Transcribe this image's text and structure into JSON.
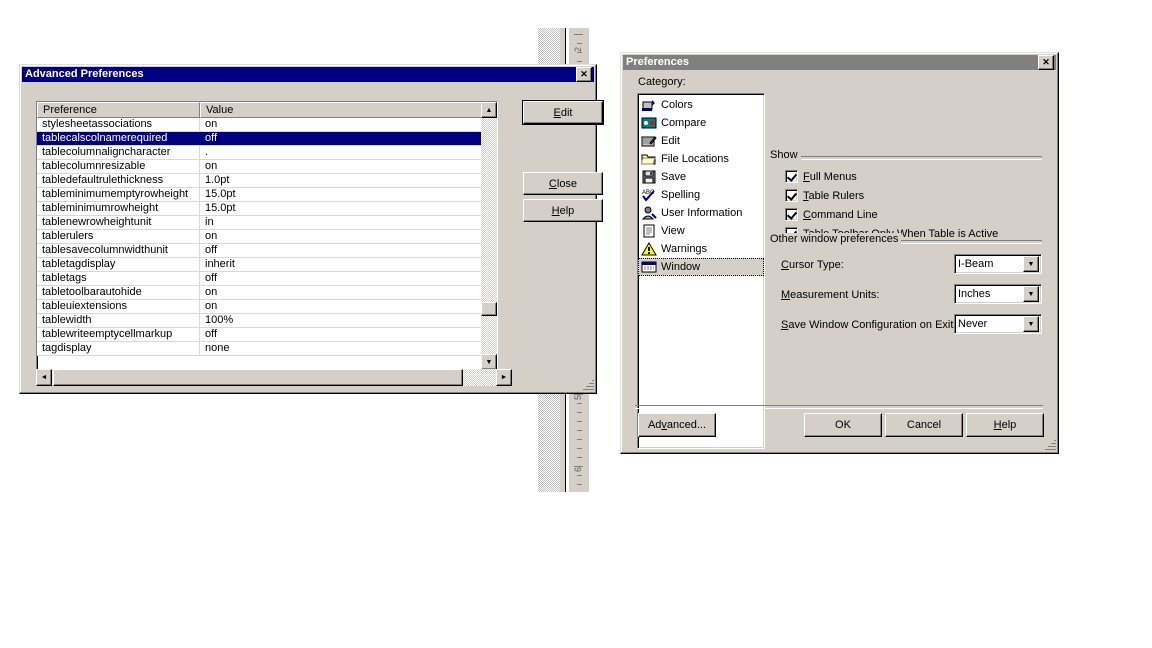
{
  "background": {
    "ruler": {
      "name": "vertical-ruler",
      "labels": [
        "2",
        "5",
        "6"
      ]
    }
  },
  "advanced_dialog": {
    "title": "Advanced Preferences",
    "close_icon": "close-icon",
    "columns": [
      "Preference",
      "Value"
    ],
    "rows": [
      {
        "preference": "stylesheetassociations",
        "value": "on",
        "selected": false
      },
      {
        "preference": "tablecalscolnamerequired",
        "value": "off",
        "selected": true
      },
      {
        "preference": "tablecolumnaligncharacter",
        "value": ".",
        "selected": false
      },
      {
        "preference": "tablecolumnresizable",
        "value": "on",
        "selected": false
      },
      {
        "preference": "tabledefaultrulethickness",
        "value": "1.0pt",
        "selected": false
      },
      {
        "preference": "tableminimumemptyrowheight",
        "value": "15.0pt",
        "selected": false
      },
      {
        "preference": "tableminimumrowheight",
        "value": "15.0pt",
        "selected": false
      },
      {
        "preference": "tablenewrowheightunit",
        "value": "in",
        "selected": false
      },
      {
        "preference": "tablerulers",
        "value": "on",
        "selected": false
      },
      {
        "preference": "tablesavecolumnwidthunit",
        "value": "off",
        "selected": false
      },
      {
        "preference": "tabletagdisplay",
        "value": "inherit",
        "selected": false
      },
      {
        "preference": "tabletags",
        "value": "off",
        "selected": false
      },
      {
        "preference": "tabletoolbarautohide",
        "value": "on",
        "selected": false
      },
      {
        "preference": "tableuiextensions",
        "value": "on",
        "selected": false
      },
      {
        "preference": "tablewidth",
        "value": "100%",
        "selected": false
      },
      {
        "preference": "tablewriteemptycellmarkup",
        "value": "off",
        "selected": false
      },
      {
        "preference": "tagdisplay",
        "value": "none",
        "selected": false
      }
    ],
    "buttons": {
      "edit": "Edit",
      "close": "Close",
      "help": "Help"
    },
    "scroll": {
      "up_arrow": "▲",
      "down_arrow": "▼",
      "left_arrow": "◄",
      "right_arrow": "►"
    }
  },
  "preferences_dialog": {
    "title": "Preferences",
    "close_icon": "close-icon",
    "category_label": "Category:",
    "categories": [
      {
        "label": "Colors",
        "icon": "colors-icon",
        "selected": false
      },
      {
        "label": "Compare",
        "icon": "compare-icon",
        "selected": false
      },
      {
        "label": "Edit",
        "icon": "edit-icon",
        "selected": false
      },
      {
        "label": "File Locations",
        "icon": "folder-icon",
        "selected": false
      },
      {
        "label": "Save",
        "icon": "floppy-disk-icon",
        "selected": false
      },
      {
        "label": "Spelling",
        "icon": "spelling-abc-icon",
        "selected": false
      },
      {
        "label": "User Information",
        "icon": "user-icon",
        "selected": false
      },
      {
        "label": "View",
        "icon": "document-icon",
        "selected": false
      },
      {
        "label": "Warnings",
        "icon": "warning-triangle-icon",
        "selected": false
      },
      {
        "label": "Window",
        "icon": "window-icon",
        "selected": true
      }
    ],
    "show_group": {
      "title": "Show",
      "checkboxes": [
        {
          "label": "Full Menus",
          "accel": "F",
          "checked": true
        },
        {
          "label": "Table Rulers",
          "accel": "T",
          "checked": true
        },
        {
          "label": "Command Line",
          "accel": "C",
          "checked": true
        },
        {
          "label": "Table Toolbar Only When Table is Active",
          "accel": "T",
          "checked": true
        }
      ]
    },
    "other_group": {
      "title": "Other window preferences",
      "fields": [
        {
          "label": "Cursor Type:",
          "accel": "u",
          "value": "I-Beam"
        },
        {
          "label": "Measurement Units:",
          "accel": "M",
          "value": "Inches"
        },
        {
          "label": "Save Window Configuration on Exit:",
          "accel": "S",
          "value": "Never"
        }
      ]
    },
    "buttons": {
      "advanced": "Advanced...",
      "ok": "OK",
      "cancel": "Cancel",
      "help": "Help"
    }
  }
}
